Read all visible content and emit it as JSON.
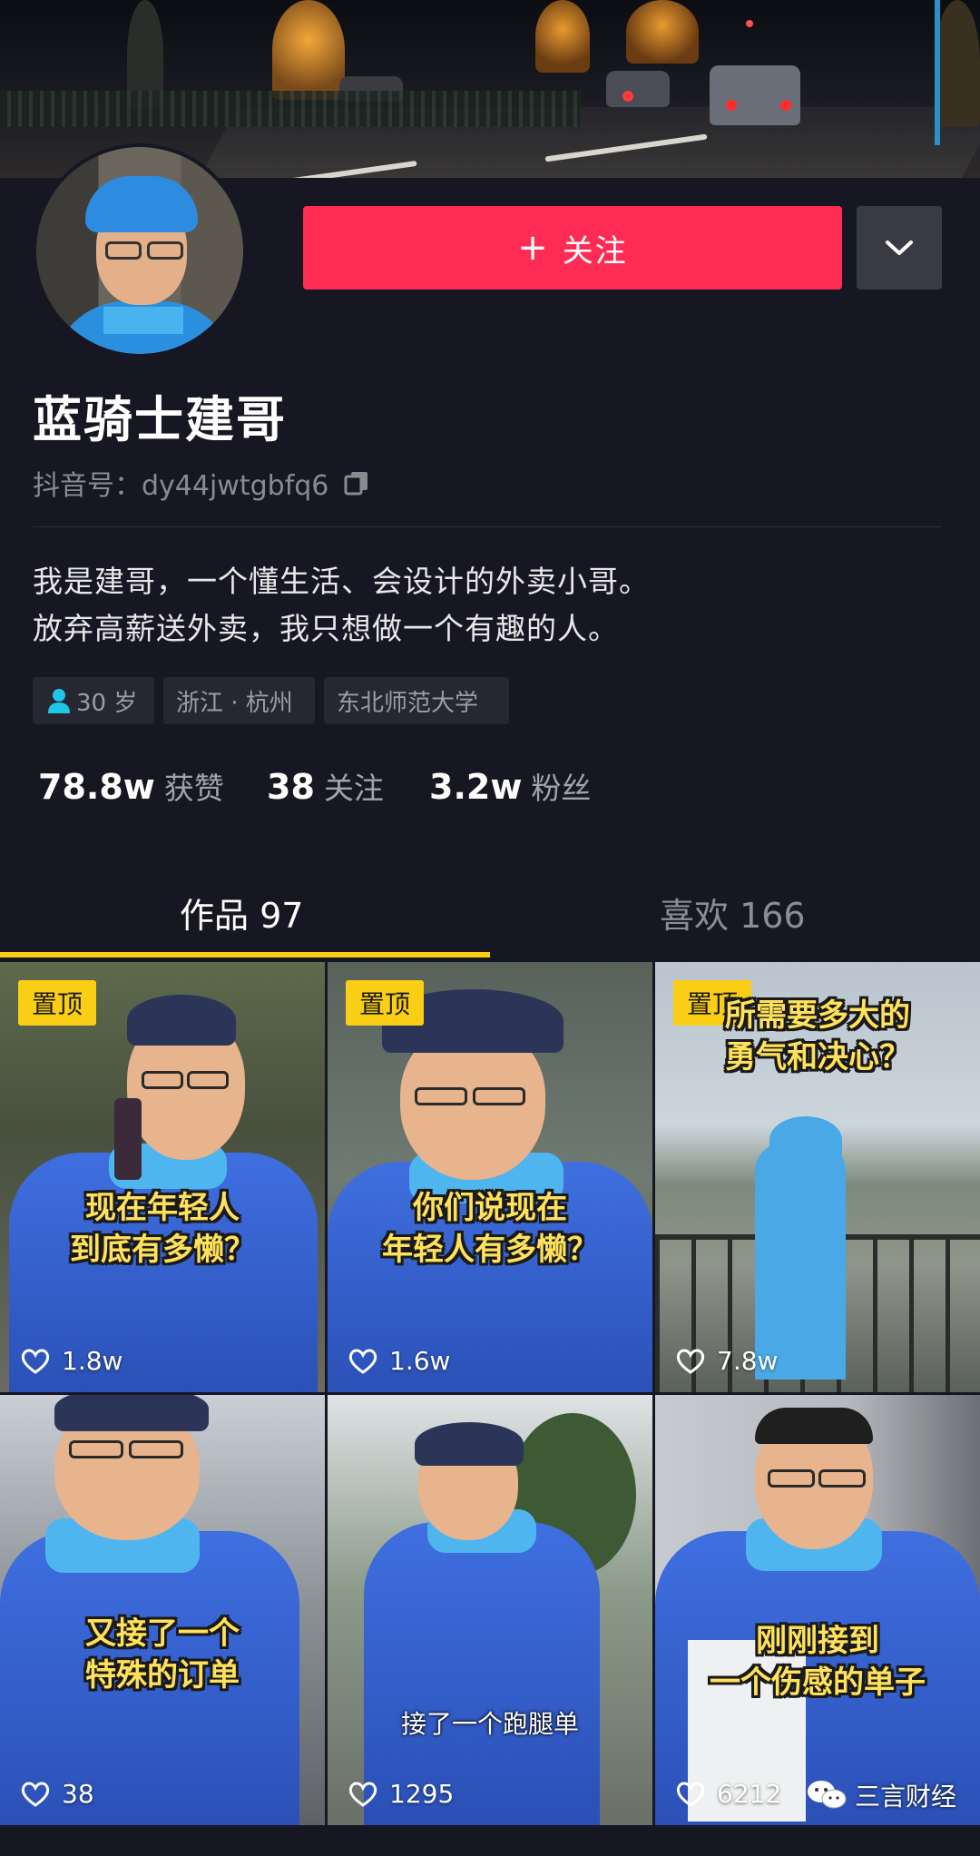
{
  "profile": {
    "follow_label": "关注",
    "name": "蓝骑士建哥",
    "account_id": "抖音号：dy44jwtgbfq6",
    "bio": [
      "我是建哥，一个懂生活、会设计的外卖小哥。",
      "放弃高薪送外卖，我只想做一个有趣的人。"
    ],
    "tags": [
      "30 岁",
      "浙江 · 杭州",
      "东北师范大学"
    ],
    "stats": [
      {
        "value": "78.8w",
        "label": "获赞"
      },
      {
        "value": "38",
        "label": "关注"
      },
      {
        "value": "3.2w",
        "label": "粉丝"
      }
    ]
  },
  "tabs": [
    {
      "label": "作品 97",
      "active": true
    },
    {
      "label": "喜欢 166",
      "active": false
    }
  ],
  "videos": [
    {
      "pinned": "置顶",
      "caption": [
        "现在年轻人",
        "到底有多懒？"
      ],
      "likes": "1.8w"
    },
    {
      "pinned": "置顶",
      "caption": [
        "你们说现在",
        "年轻人有多懒？"
      ],
      "likes": "1.6w"
    },
    {
      "pinned": "置顶",
      "caption": [
        "所需要多大的",
        "勇气和决心？"
      ],
      "likes": "7.8w"
    },
    {
      "caption": [
        "又接了一个",
        "特殊的订单"
      ],
      "likes": "38"
    },
    {
      "caption": [
        "接了一个跑腿单"
      ],
      "likes": "1295"
    },
    {
      "caption": [
        "刚刚接到",
        "一个伤感的单子"
      ],
      "likes": "6212"
    }
  ],
  "watermark": "三言财经",
  "colors": {
    "background": "#161722",
    "follow": "#fe2c55",
    "pin": "#face15",
    "tab_indicator": "#face15"
  }
}
